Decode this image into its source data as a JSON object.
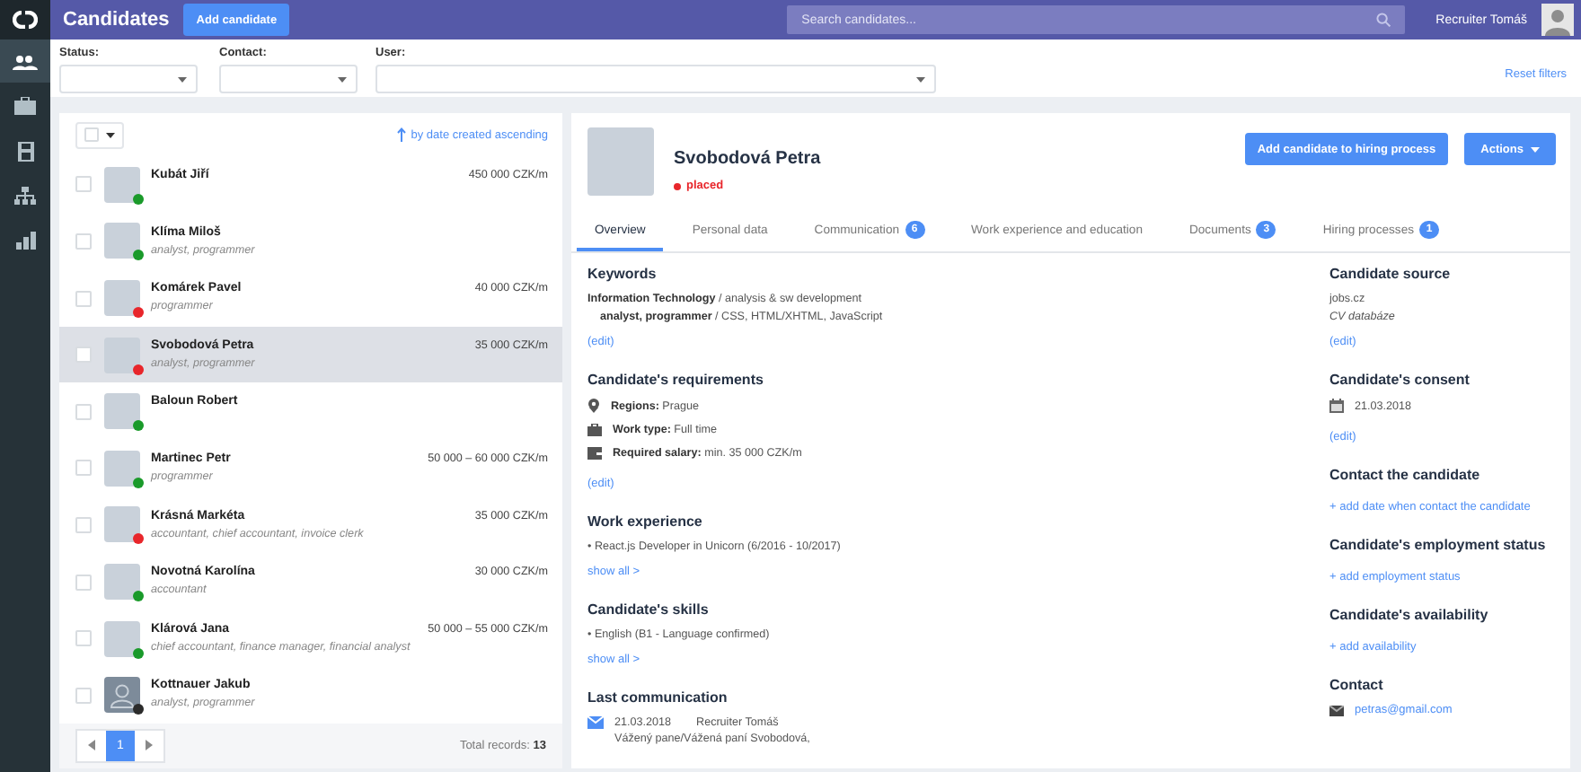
{
  "sidebar": {
    "items": [
      {
        "kind": "people",
        "selected": true
      },
      {
        "kind": "briefcase",
        "selected": false
      },
      {
        "kind": "disk",
        "selected": false
      },
      {
        "kind": "org",
        "selected": false
      },
      {
        "kind": "chart",
        "selected": false
      }
    ]
  },
  "header": {
    "title": "Candidates",
    "add_button": "Add candidate",
    "search": {
      "placeholder": "Search candidates..."
    },
    "user": "Recruiter Tomáš"
  },
  "filters": {
    "fields": [
      {
        "label": "Status:"
      },
      {
        "label": "Contact:"
      },
      {
        "label": "User:"
      }
    ],
    "reset": "Reset filters"
  },
  "list": {
    "sort": "by date created ascending",
    "candidates": [
      {
        "name": "Kubát Jiří",
        "salary": "450 000 CZK/m",
        "kind": "photo",
        "color": "#1a9a2a",
        "selected": false,
        "checked": false
      },
      {
        "name": "Klíma Miloš",
        "roles": "analyst, programmer",
        "kind": "photo",
        "color": "#1a9a2a",
        "selected": false,
        "checked": false
      },
      {
        "name": "Komárek Pavel",
        "roles": "programmer",
        "salary": "40 000 CZK/m",
        "kind": "photo",
        "color": "#e8262b",
        "selected": false,
        "checked": false
      },
      {
        "name": "Svobodová Petra",
        "roles": "analyst, programmer",
        "salary": "35 000 CZK/m",
        "kind": "photo",
        "color": "#e8262b",
        "selected": true,
        "checked": false
      },
      {
        "name": "Baloun Robert",
        "kind": "photo",
        "color": "#1a9a2a",
        "selected": false,
        "checked": false
      },
      {
        "name": "Martinec Petr",
        "roles": "programmer",
        "salary": "50 000 – 60 000 CZK/m",
        "kind": "photo",
        "color": "#1a9a2a",
        "selected": false,
        "checked": false
      },
      {
        "name": "Krásná Markéta",
        "roles": "accountant, chief accountant, invoice clerk",
        "salary": "35 000 CZK/m",
        "kind": "photo",
        "color": "#e8262b",
        "selected": false,
        "checked": false
      },
      {
        "name": "Novotná Karolína",
        "roles": "accountant",
        "salary": "30 000 CZK/m",
        "kind": "photo",
        "color": "#1a9a2a",
        "selected": false,
        "checked": false
      },
      {
        "name": "Klárová Jana",
        "roles": "chief accountant, finance manager, financial analyst",
        "salary": "50 000 – 55 000 CZK/m",
        "kind": "photo",
        "color": "#1a9a2a",
        "selected": false,
        "checked": false
      },
      {
        "name": "Kottnauer Jakub",
        "roles": "analyst, programmer",
        "kind": "silhouette",
        "color": "#2b2b2b",
        "selected": false,
        "checked": false
      }
    ],
    "pages": [
      {
        "label": "1",
        "selected": true
      }
    ],
    "total": "Total records: **13**"
  },
  "detail": {
    "name": "Svobodová Petra",
    "status": {
      "label": "placed",
      "color": "#e8262b"
    },
    "buttons": {
      "primary": "Add candidate to hiring process",
      "actions": "Actions"
    },
    "tabs": [
      {
        "label": "Overview",
        "selected": true
      },
      {
        "label": "Personal data",
        "selected": false
      },
      {
        "label": "Communication",
        "badge": "6",
        "selected": false
      },
      {
        "label": "Work experience and education",
        "selected": false
      },
      {
        "label": "Documents",
        "badge": "3",
        "selected": false
      },
      {
        "label": "Hiring processes",
        "badge": "1",
        "selected": false
      }
    ],
    "main_sections": [
      {
        "title": "Keywords",
        "items": [
          {
            "kind": "text",
            "text": "**Information Technology** / analysis & sw development"
          },
          {
            "kind": "indent",
            "text": "**analyst, programmer** / CSS, HTML/XHTML, JavaScript"
          }
        ],
        "link": "(edit)"
      },
      {
        "title": "Candidate's requirements",
        "items": [
          {
            "kind": "region",
            "text": "**Regions:** Prague"
          },
          {
            "kind": "work-type",
            "text": "**Work type:** Full time"
          },
          {
            "kind": "salary",
            "text": "**Required salary:** min. 35 000 CZK/m"
          }
        ],
        "link": "(edit)"
      },
      {
        "title": "Work experience",
        "items": [
          {
            "kind": "text",
            "text": "• React.js Developer in Unicorn (6/2016 - 10/2017)"
          }
        ],
        "link": "show all >"
      },
      {
        "title": "Candidate's skills",
        "items": [
          {
            "kind": "text",
            "text": "• English (B1 - Language confirmed)"
          }
        ],
        "link": "show all >"
      },
      {
        "title": "Last communication",
        "items": [
          {
            "kind": "message",
            "date": "21.03.2018",
            "author": "Recruiter Tomáš",
            "text": "Vážený pane/Vážená paní Svobodová,"
          }
        ]
      }
    ],
    "side_sections": [
      {
        "title": "Candidate source",
        "items": [
          {
            "kind": "text",
            "text": "jobs.cz"
          },
          {
            "kind": "note",
            "text": "CV databáze"
          }
        ],
        "link": "(edit)"
      },
      {
        "title": "Candidate's consent",
        "items": [
          {
            "kind": "date",
            "text": "21.03.2018"
          }
        ],
        "link": "(edit)"
      },
      {
        "title": "Contact the candidate",
        "link": "+ add date when contact the candidate"
      },
      {
        "title": "Candidate's employment status",
        "link": "+ add employment status"
      },
      {
        "title": "Candidate's availability",
        "link": "+ add availability"
      },
      {
        "title": "Contact",
        "items": [
          {
            "kind": "email",
            "text": "petras@gmail.com"
          }
        ]
      }
    ]
  }
}
